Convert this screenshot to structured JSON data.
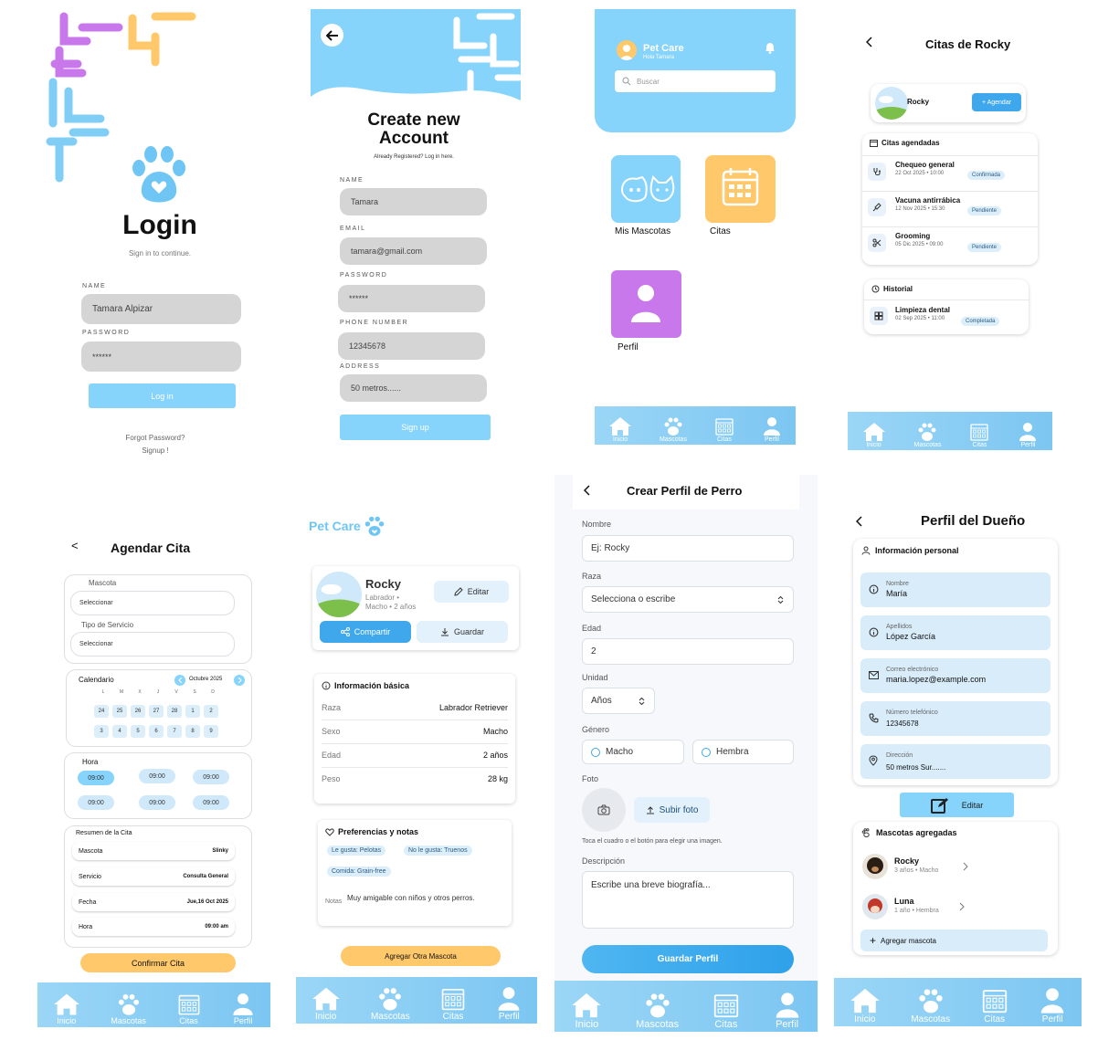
{
  "colors": {
    "accent": "#86d3fb",
    "nav": "#86cdf6",
    "orange": "#ffc96b",
    "purple": "#c978ec",
    "confirmada": "#dbeefa"
  },
  "login": {
    "title": "Login",
    "subtitle": "Sign in to continue.",
    "name_label": "NAME",
    "name_value": "Tamara Alpizar",
    "password_label": "PASSWORD",
    "password_value": "******",
    "login_button": "Log in",
    "forgot": "Forgot Password?",
    "signup": "Signup !"
  },
  "register": {
    "title_line1": "Create new",
    "title_line2": "Account",
    "subtitle": "Already Registered? Log in here.",
    "fields": [
      {
        "label": "NAME",
        "value": "Tamara"
      },
      {
        "label": "EMAIL",
        "value": "tamara@gmail.com"
      },
      {
        "label": "PASSWORD",
        "value": "******"
      },
      {
        "label": "PHONE NUMBER",
        "value": "12345678"
      },
      {
        "label": "ADDRESS",
        "value": "50 metros......"
      }
    ],
    "signup_button": "Sign up"
  },
  "home": {
    "app_name": "Pet Care",
    "greeting": "Hola Tamara",
    "search_placeholder": "Buscar",
    "tiles": [
      {
        "label": "Mis Mascotas"
      },
      {
        "label": "Citas"
      },
      {
        "label": "Perfil"
      }
    ]
  },
  "nav": {
    "inicio": "Inicio",
    "mascotas": "Mascotas",
    "citas": "Citas",
    "perfil": "Perfil"
  },
  "citas_rocky": {
    "title": "Citas de Rocky",
    "pet_name": "Rocky",
    "agendar_button": "+ Agendar",
    "agendadas_title": "Citas agendadas",
    "agendadas": [
      {
        "title": "Chequeo general",
        "date": "22 Oct 2025 • 10:00",
        "status": "Confirmada"
      },
      {
        "title": "Vacuna antirrábica",
        "date": "12 Nov 2025 • 15:30",
        "status": "Pendiente"
      },
      {
        "title": "Grooming",
        "date": "05 Dic 2025 • 09:00",
        "status": "Pendiente"
      }
    ],
    "historial_title": "Historial",
    "historial": [
      {
        "title": "Limpieza dental",
        "date": "02 Sep 2025 • 11:00",
        "status": "Completada"
      }
    ]
  },
  "agendar": {
    "title": "Agendar Cita",
    "back": "<",
    "mascota_label": "Mascota",
    "mascota_value": "Seleccionar",
    "servicio_label": "Tipo de Servicio",
    "servicio_value": "Seleccionar",
    "calendario_label": "Calendario",
    "month": "Octubre 2025",
    "weekdays": [
      "L",
      "M",
      "X",
      "J",
      "V",
      "S",
      "D"
    ],
    "days_row1": [
      "24",
      "25",
      "26",
      "27",
      "28",
      "1",
      "2"
    ],
    "days_row2": [
      "3",
      "4",
      "5",
      "6",
      "7",
      "8",
      "9"
    ],
    "hora_label": "Hora",
    "times": [
      "09:00",
      "09:00",
      "09:00",
      "09:00",
      "09:00",
      "09:00"
    ],
    "resumen_title": "Resumen de la Cita",
    "resumen": [
      {
        "k": "Mascota",
        "v": "Slinky"
      },
      {
        "k": "Servicio",
        "v": "Consulta General"
      },
      {
        "k": "Fecha",
        "v": "Jue,16 Oct 2025"
      },
      {
        "k": "Hora",
        "v": "09:00 am"
      }
    ],
    "confirm_button": "Confirmar Cita"
  },
  "pet_profile": {
    "brand": "Pet Care",
    "name": "Rocky",
    "breed_line1": "Labrador •",
    "breed_line2": "Macho • 2 años",
    "edit_button": "Editar",
    "share_button": "Compartir",
    "save_button": "Guardar",
    "info_title": "Información básica",
    "info": [
      {
        "k": "Raza",
        "v": "Labrador Retriever"
      },
      {
        "k": "Sexo",
        "v": "Macho"
      },
      {
        "k": "Edad",
        "v": "2 años"
      },
      {
        "k": "Peso",
        "v": "28 kg"
      }
    ],
    "prefs_title": "Preferencias y notas",
    "chips": [
      "Le gusta: Pelotas",
      "No le gusta: Truenos",
      "Comida: Grain-free"
    ],
    "notes_label": "Notas",
    "notes": "Muy amigable con niños y otros perros.",
    "add_button": "Agregar Otra Mascota"
  },
  "crear_perro": {
    "title": "Crear Perfil de Perro",
    "back": "<",
    "nombre_label": "Nombre",
    "nombre_placeholder": "Ej: Rocky",
    "raza_label": "Raza",
    "raza_value": "Selecciona o escribe",
    "edad_label": "Edad",
    "edad_value": "2",
    "unidad_label": "Unidad",
    "unidad_value": "Años",
    "genero_label": "Género",
    "macho": "Macho",
    "hembra": "Hembra",
    "foto_label": "Foto",
    "subir_foto": "Subir foto",
    "foto_hint": "Toca el cuadro o el botón para elegir una imagen.",
    "descripcion_label": "Descripción",
    "descripcion_placeholder": "Escribe una breve biografía...",
    "guardar_button": "Guardar Perfil"
  },
  "dueno": {
    "title": "Perfil del Dueño",
    "back": "<",
    "info_title": "Información personal",
    "fields": [
      {
        "label": "Nombre",
        "value": "María"
      },
      {
        "label": "Apellidos",
        "value": "López García"
      },
      {
        "label": "Correo electrónico",
        "value": "maria.lopez@example.com"
      },
      {
        "label": "Número telefónico",
        "value": "12345678"
      },
      {
        "label": "Dirección",
        "value": "50 metros Sur......."
      }
    ],
    "edit_button": "Editar",
    "mascotas_title": "Mascotas agregadas",
    "pets": [
      {
        "name": "Rocky",
        "detail": "3 años • Macho"
      },
      {
        "name": "Luna",
        "detail": "1 año • Hembra"
      }
    ],
    "add_pet": "Agregar mascota"
  }
}
